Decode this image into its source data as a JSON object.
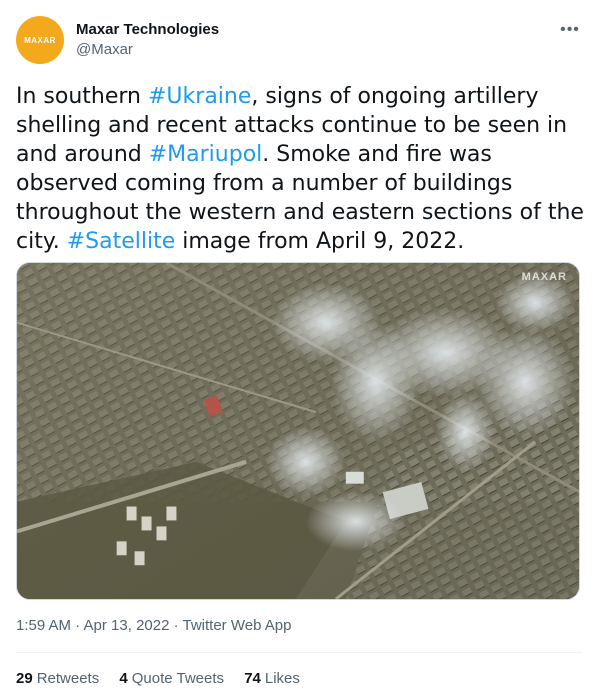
{
  "user": {
    "display_name": "Maxar Technologies",
    "handle": "@Maxar",
    "avatar_text": "MAXAR",
    "avatar_color": "#f4a81c"
  },
  "tweet": {
    "text_parts": {
      "p1": "In southern ",
      "t1": "#Ukraine",
      "p2": ", signs of ongoing artillery shelling and recent attacks continue to be seen in and around ",
      "t2": "#Mariupol",
      "p3": ". Smoke and fire was observed coming from a number of buildings throughout the western and eastern sections of the city. ",
      "t3": "#Satellite",
      "p4": " image from April 9, 2022."
    },
    "hashtag_color": "#1d9bf0",
    "media_watermark": "MAXAR"
  },
  "meta": {
    "timestamp": "1:59 AM · Apr 13, 2022 · Twitter Web App"
  },
  "stats": {
    "retweets_count": "29",
    "retweets_label": "Retweets",
    "quote_count": "4",
    "quote_label": "Quote Tweets",
    "likes_count": "74",
    "likes_label": "Likes"
  },
  "icons": {
    "more": "more-icon"
  }
}
